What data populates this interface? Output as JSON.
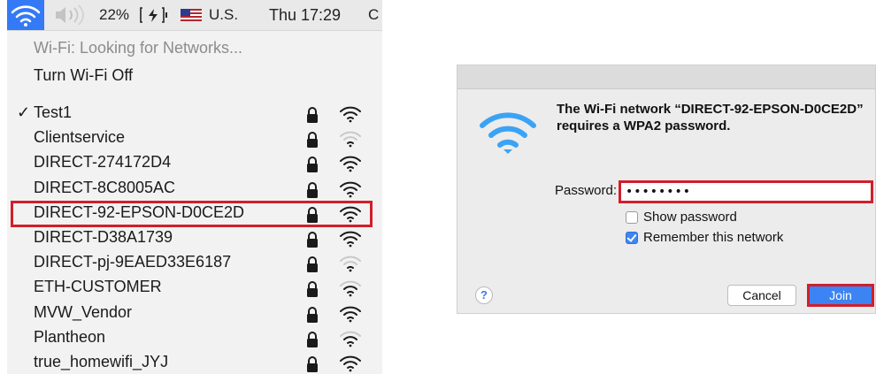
{
  "menubar": {
    "volume_icon": "speaker-icon",
    "battery_percent": "22%",
    "input_source": "U.S.",
    "clock": "Thu 17:29",
    "partial_icon": "C"
  },
  "wifi_menu": {
    "status": "Wi-Fi: Looking for Networks...",
    "toggle_label": "Turn Wi-Fi Off",
    "networks": [
      {
        "name": "Test1",
        "connected": true,
        "signal": 3
      },
      {
        "name": "Clientservice",
        "connected": false,
        "signal": 1
      },
      {
        "name": "DIRECT-274172D4",
        "connected": false,
        "signal": 3
      },
      {
        "name": "DIRECT-8C8005AC",
        "connected": false,
        "signal": 3
      },
      {
        "name": "DIRECT-92-EPSON-D0CE2D",
        "connected": false,
        "signal": 3
      },
      {
        "name": "DIRECT-D38A1739",
        "connected": false,
        "signal": 3
      },
      {
        "name": "DIRECT-pj-9EAED33E6187",
        "connected": false,
        "signal": 1
      },
      {
        "name": "ETH-CUSTOMER",
        "connected": false,
        "signal": 2
      },
      {
        "name": "MVW_Vendor",
        "connected": false,
        "signal": 3
      },
      {
        "name": "Plantheon",
        "connected": false,
        "signal": 2
      },
      {
        "name": "true_homewifi_JYJ",
        "connected": false,
        "signal": 3
      }
    ]
  },
  "dialog": {
    "message": "The Wi-Fi network “DIRECT-92-EPSON-D0CE2D” requires a WPA2 password.",
    "password_label": "Password:",
    "password_value": "••••••••",
    "show_password_label": "Show password",
    "show_password_checked": false,
    "remember_label": "Remember this network",
    "remember_checked": true,
    "help_label": "?",
    "cancel_label": "Cancel",
    "join_label": "Join"
  },
  "colors": {
    "accent": "#3479f6",
    "highlight": "#d11f2a",
    "wifi_icon": "#3aa3f5"
  }
}
